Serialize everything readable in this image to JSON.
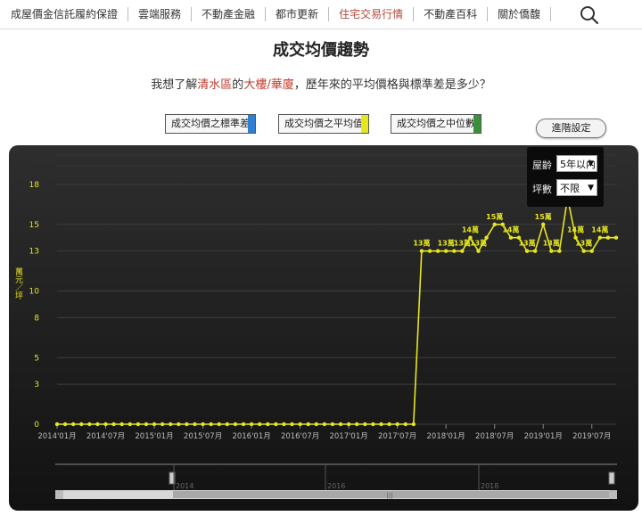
{
  "nav": {
    "items": [
      "成屋價金信託履約保證",
      "雲端服務",
      "不動產金融",
      "都市更新",
      "住宅交易行情",
      "不動產百科",
      "關於僑馥"
    ],
    "active_index": 4
  },
  "page_title": "成交均價趨勢",
  "question": {
    "prefix": "我想了解",
    "district": "清水區",
    "mid": "的",
    "building_type": "大樓/華廈",
    "suffix": "，歷年來的平均價格與標準差是多少？"
  },
  "stat_buttons": [
    {
      "label": "成交均價之標準差",
      "color": "#2f7fd6"
    },
    {
      "label": "成交均價之平均值",
      "color": "#e6e620"
    },
    {
      "label": "成交均價之中位數",
      "color": "#3a8f3a"
    }
  ],
  "advanced_button": "進階設定",
  "filters": {
    "age_label": "屋齡",
    "age_value": "5年以內",
    "area_label": "坪數",
    "area_value": "不限"
  },
  "colors": {
    "line": "#e6e620",
    "accent": "#b5473a"
  },
  "chart_data": {
    "type": "line",
    "ylabel": "萬元／坪",
    "yticks": [
      0,
      3,
      5,
      8,
      10,
      13,
      15,
      18
    ],
    "ylim": [
      0,
      19
    ],
    "x_tick_labels": [
      "2014'01月",
      "2014'07月",
      "2015'01月",
      "2015'07月",
      "2016'01月",
      "2016'07月",
      "2017'01月",
      "2017'07月",
      "2018'01月",
      "2018'07月",
      "2019'01月",
      "2019'07月"
    ],
    "x_tick_index": [
      0,
      6,
      12,
      18,
      24,
      30,
      36,
      42,
      48,
      54,
      60,
      66
    ],
    "series": [
      {
        "values": [
          0,
          0,
          0,
          0,
          0,
          0,
          0,
          0,
          0,
          0,
          0,
          0,
          0,
          0,
          0,
          0,
          0,
          0,
          0,
          0,
          0,
          0,
          0,
          0,
          0,
          0,
          0,
          0,
          0,
          0,
          0,
          0,
          0,
          0,
          0,
          0,
          0,
          0,
          0,
          0,
          0,
          0,
          0,
          0,
          0,
          13,
          13,
          13,
          13,
          13,
          13,
          14,
          13,
          14,
          15,
          15,
          14,
          14,
          13,
          13,
          15,
          13,
          13,
          17,
          14,
          13,
          13,
          14,
          14,
          14
        ]
      }
    ],
    "data_labels": [
      {
        "i": 45,
        "text": "13萬"
      },
      {
        "i": 48,
        "text": "13萬"
      },
      {
        "i": 50,
        "text": "13萬"
      },
      {
        "i": 51,
        "text": "14萬"
      },
      {
        "i": 52,
        "text": "13萬"
      },
      {
        "i": 54,
        "text": "15萬"
      },
      {
        "i": 56,
        "text": "14萬"
      },
      {
        "i": 58,
        "text": "13萬"
      },
      {
        "i": 60,
        "text": "15萬"
      },
      {
        "i": 61,
        "text": "13萬"
      },
      {
        "i": 64,
        "text": "14萬"
      },
      {
        "i": 65,
        "text": "13萬"
      },
      {
        "i": 67,
        "text": "14萬"
      }
    ],
    "navigator_labels": [
      "2014",
      "2016",
      "2018"
    ]
  }
}
